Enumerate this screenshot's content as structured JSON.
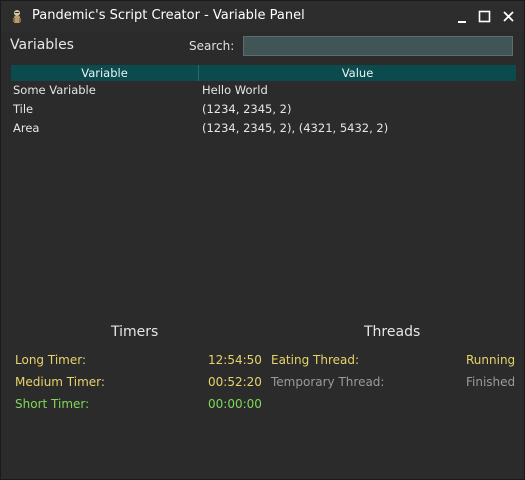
{
  "window": {
    "title": "Pandemic's Script Creator - Variable Panel",
    "controls": {
      "minimize": "minimize",
      "maximize": "maximize",
      "close": "close"
    }
  },
  "panel": {
    "title": "Variables",
    "search_label": "Search:",
    "search_value": "",
    "search_placeholder": ""
  },
  "table": {
    "columns": [
      "Variable",
      "Value"
    ],
    "rows": [
      {
        "variable": "Some Variable",
        "value": "Hello World"
      },
      {
        "variable": "Tile",
        "value": "(1234, 2345, 2)"
      },
      {
        "variable": "Area",
        "value": "(1234, 2345, 2), (4321, 5432, 2)"
      }
    ]
  },
  "timers": {
    "title": "Timers",
    "items": [
      {
        "label": "Long Timer:",
        "value": "12:54:50",
        "status_color": "#e6d36b"
      },
      {
        "label": "Medium Timer:",
        "value": "00:52:20",
        "status_color": "#e6d36b"
      },
      {
        "label": "Short Timer:",
        "value": "00:00:00",
        "status_color": "#7ed957"
      }
    ]
  },
  "threads": {
    "title": "Threads",
    "items": [
      {
        "label": "Eating Thread:",
        "value": "Running",
        "status_color": "#e6d36b"
      },
      {
        "label": "Temporary Thread:",
        "value": "Finished",
        "status_color": "#9a9a9a"
      }
    ]
  },
  "colors": {
    "header_bg": "#0b4b4e",
    "search_bg": "#415456",
    "window_bg": "#2b2b2b"
  }
}
